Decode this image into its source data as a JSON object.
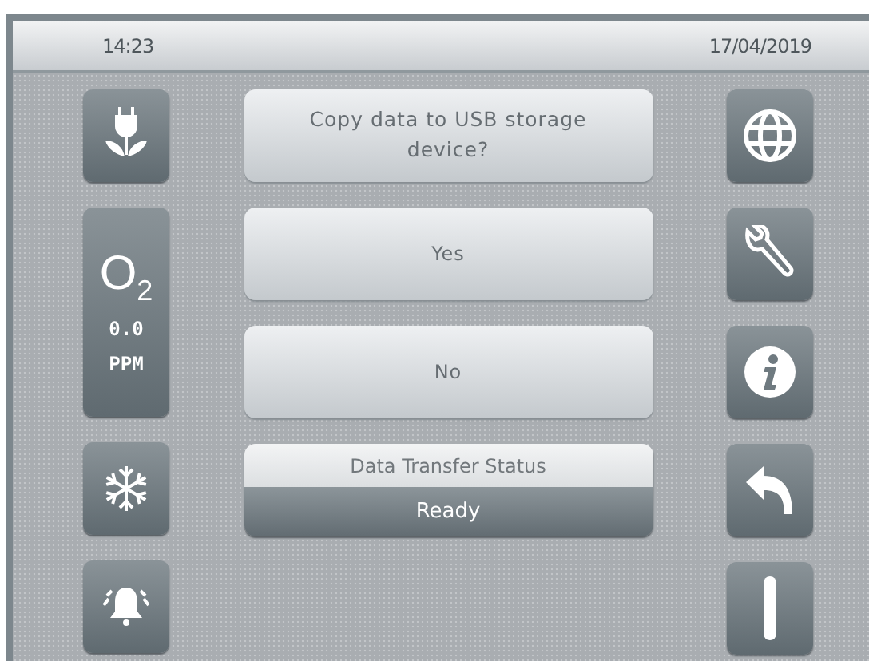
{
  "status_bar": {
    "time": "14:23",
    "date": "17/04/2019"
  },
  "left_buttons": [
    {
      "kind": "plug"
    },
    {
      "kind": "oxygen",
      "symbol": "O",
      "subscript": "2",
      "value": "0.0",
      "unit": "PPM"
    },
    {
      "kind": "snowflake"
    },
    {
      "kind": "bell"
    }
  ],
  "dialog": {
    "question": "Copy data to USB storage device?",
    "buttons": [
      "Yes",
      "No"
    ],
    "status_label": "Data Transfer Status",
    "status_value": "Ready"
  },
  "right_buttons": [
    {
      "kind": "globe"
    },
    {
      "kind": "wrench"
    },
    {
      "kind": "info"
    },
    {
      "kind": "back"
    },
    {
      "kind": "power"
    }
  ]
}
